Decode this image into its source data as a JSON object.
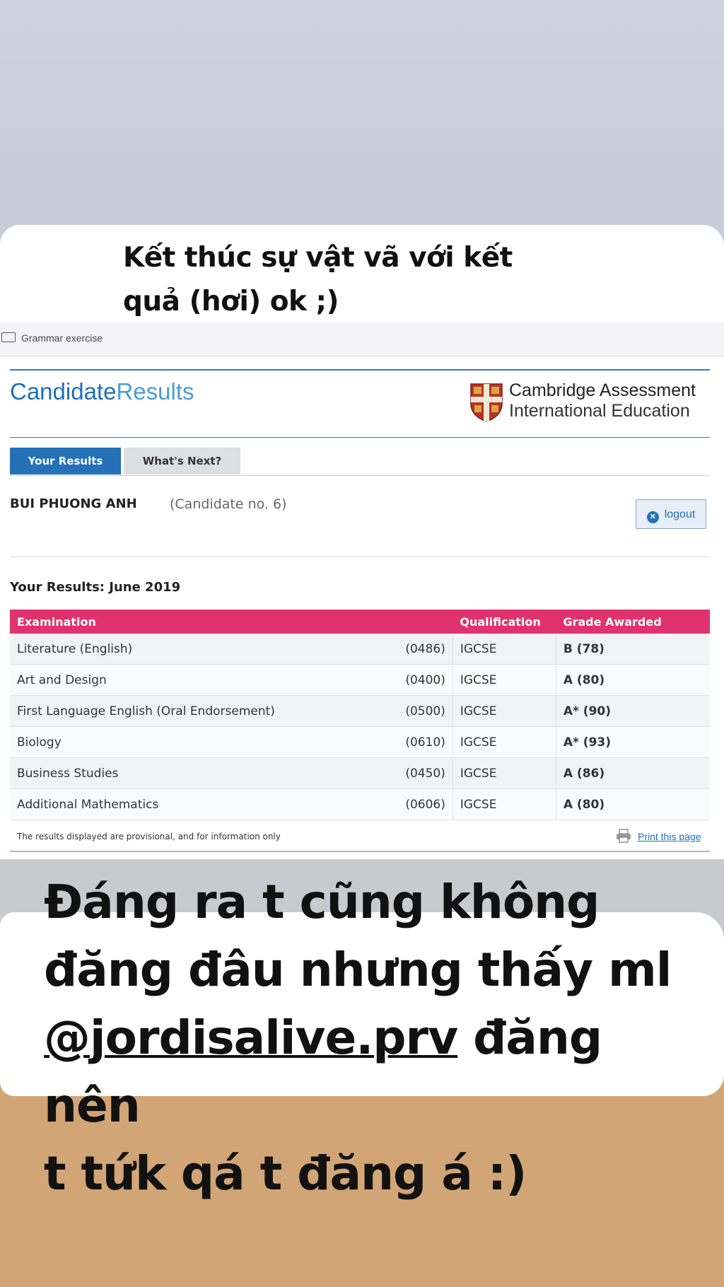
{
  "captions": {
    "top_line1": "Kết thúc sự vật vã với kết",
    "top_line2": "quả (hơi) ok ;)",
    "bottom_line1": "Đáng ra t cũng không",
    "bottom_line2": "đăng đâu nhưng thấy ml",
    "bottom_mention": "@jordisalive.prv",
    "bottom_line3_rest": " đăng nên",
    "bottom_line4": "t tứk qá t đăng á :)"
  },
  "browser": {
    "bookmark_label": "Grammar exercise"
  },
  "header": {
    "brand_part1": "Candidate",
    "brand_part2": "Results",
    "org_line1": "Cambridge Assessment",
    "org_line2": "International Education"
  },
  "tabs": [
    {
      "label": "Your Results",
      "active": true
    },
    {
      "label": "What's Next?",
      "active": false
    }
  ],
  "candidate": {
    "name": "BUI PHUONG ANH",
    "number": "(Candidate no. 6)"
  },
  "logout_label": "logout",
  "results": {
    "heading": "Your Results: June 2019",
    "columns": [
      "Examination",
      "Qualification",
      "Grade Awarded"
    ],
    "rows": [
      {
        "exam": "Literature (English)",
        "code": "(0486)",
        "qualification": "IGCSE",
        "grade": "B (78)"
      },
      {
        "exam": "Art and Design",
        "code": "(0400)",
        "qualification": "IGCSE",
        "grade": "A (80)"
      },
      {
        "exam": "First Language English (Oral Endorsement)",
        "code": "(0500)",
        "qualification": "IGCSE",
        "grade": "A* (90)"
      },
      {
        "exam": "Biology",
        "code": "(0610)",
        "qualification": "IGCSE",
        "grade": "A* (93)"
      },
      {
        "exam": "Business Studies",
        "code": "(0450)",
        "qualification": "IGCSE",
        "grade": "A (86)"
      },
      {
        "exam": "Additional Mathematics",
        "code": "(0606)",
        "qualification": "IGCSE",
        "grade": "A (80)"
      }
    ],
    "footnote": "The results displayed are provisional, and for information only",
    "print_label": "Print this page"
  },
  "colors": {
    "accent_blue": "#2471b7",
    "table_header_pink": "#e0336e",
    "caption_text": "#111111"
  }
}
